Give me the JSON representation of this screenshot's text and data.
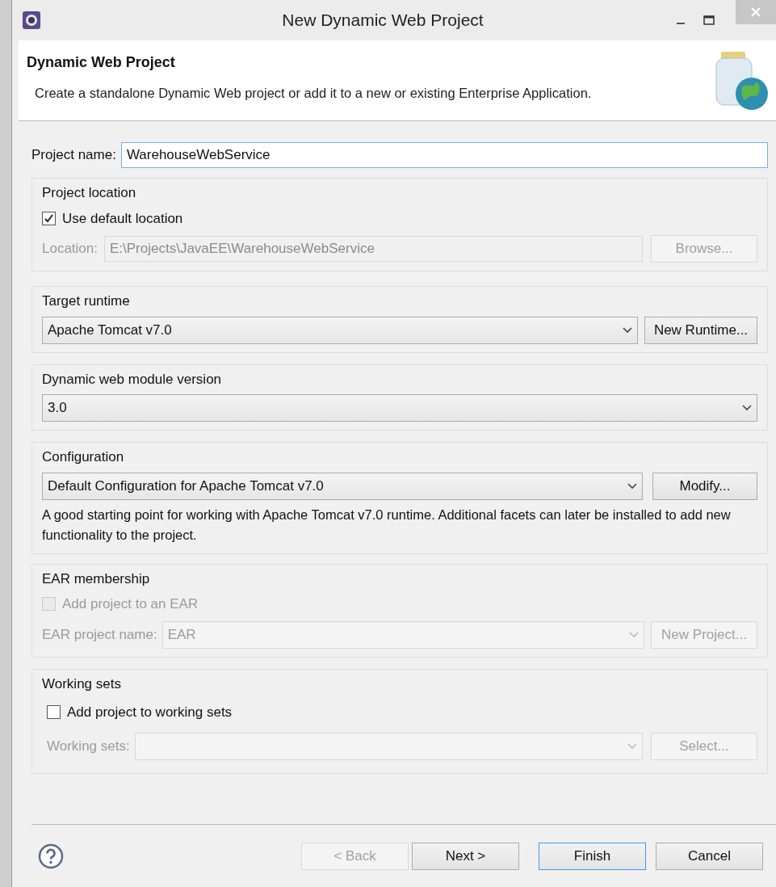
{
  "window": {
    "title": "New Dynamic Web Project"
  },
  "header": {
    "title": "Dynamic Web Project",
    "description": "Create a standalone Dynamic Web project or add it to a new or existing Enterprise Application."
  },
  "project_name": {
    "label": "Project name:",
    "value": "WarehouseWebService"
  },
  "project_location": {
    "title": "Project location",
    "use_default": {
      "label": "Use default location",
      "checked": true,
      "disabled": false
    },
    "location": {
      "label": "Location:",
      "value": "E:\\Projects\\JavaEE\\WarehouseWebService",
      "disabled": true
    },
    "button": {
      "label": "Browse...",
      "disabled": true
    }
  },
  "target_runtime": {
    "title": "Target runtime",
    "select": {
      "value": "Apache Tomcat v7.0",
      "disabled": false
    },
    "button": {
      "label": "New Runtime...",
      "disabled": false
    }
  },
  "module_version": {
    "title": "Dynamic web module version",
    "select": {
      "value": "3.0",
      "disabled": false
    }
  },
  "configuration": {
    "title": "Configuration",
    "select": {
      "value": "Default Configuration for Apache Tomcat v7.0",
      "disabled": false
    },
    "button": {
      "label": "Modify...",
      "disabled": false
    },
    "description": "A good starting point for working with Apache Tomcat v7.0 runtime. Additional facets can later be installed to add new functionality to the project."
  },
  "ear_membership": {
    "title": "EAR membership",
    "add_to_ear": {
      "label": "Add project to an EAR",
      "checked": false,
      "disabled": true
    },
    "ear_name": {
      "label": "EAR project name:",
      "value": "EAR",
      "disabled": true
    },
    "button": {
      "label": "New Project...",
      "disabled": true
    }
  },
  "working_sets": {
    "title": "Working sets",
    "add": {
      "label": "Add project to working sets",
      "checked": false,
      "disabled": false
    },
    "sets": {
      "label": "Working sets:",
      "disabled": true
    },
    "button": {
      "label": "Select...",
      "disabled": true
    }
  },
  "buttons": [
    {
      "label": "< Back",
      "disabled": true,
      "default": false
    },
    {
      "label": "Next >",
      "disabled": false,
      "default": false
    },
    {
      "label": "Finish",
      "disabled": false,
      "default": true
    },
    {
      "label": "Cancel",
      "disabled": false,
      "default": false
    }
  ]
}
